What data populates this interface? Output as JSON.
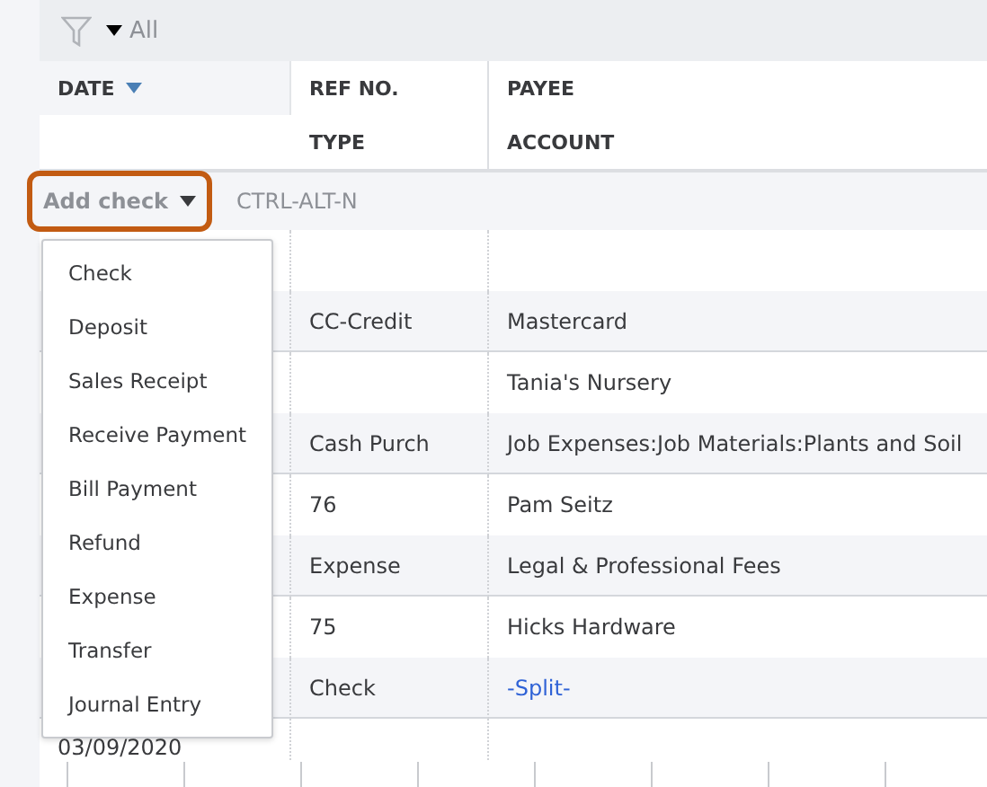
{
  "filter": {
    "label": "All"
  },
  "columns": {
    "date": "DATE",
    "ref": "REF NO.",
    "type": "TYPE",
    "payee": "PAYEE",
    "account": "ACCOUNT"
  },
  "add_button": {
    "label": "Add check",
    "shortcut": "CTRL-ALT-N",
    "highlighted": true
  },
  "menu": {
    "items": [
      "Check",
      "Deposit",
      "Sales Receipt",
      "Receive Payment",
      "Bill Payment",
      "Refund",
      "Expense",
      "Transfer",
      "Journal Entry"
    ]
  },
  "transactions": [
    {
      "type": "CC-Credit",
      "account": "Mastercard",
      "account_is_link": false
    },
    {
      "payee": "Tania's Nursery",
      "type": "Cash Purch",
      "account": "Job Expenses:Job Materials:Plants and Soil",
      "account_is_link": false
    },
    {
      "ref": "76",
      "payee": "Pam Seitz",
      "type": "Expense",
      "account": "Legal & Professional Fees",
      "account_is_link": false
    },
    {
      "ref": "75",
      "payee": "Hicks Hardware",
      "type": "Check",
      "account": "-Split-",
      "account_is_link": true
    },
    {
      "date": "03/09/2020"
    }
  ]
}
